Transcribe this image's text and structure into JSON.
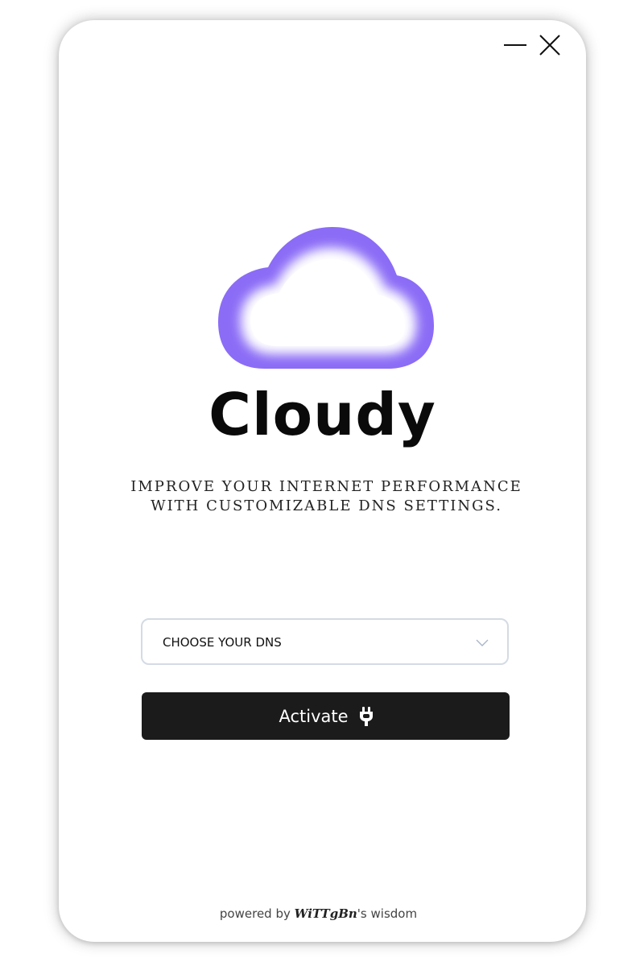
{
  "window": {
    "minimize_icon": "minimize-icon",
    "close_icon": "close-icon"
  },
  "app": {
    "title": "Cloudy",
    "logo_icon": "cloud-icon",
    "tagline_line1": "IMPROVE YOUR INTERNET PERFORMANCE",
    "tagline_line2": "WITH CUSTOMIZABLE DNS SETTINGS."
  },
  "dns_select": {
    "selected": "CHOOSE YOUR DNS",
    "icon": "chevron-down-icon"
  },
  "activate_button": {
    "label": "Activate",
    "icon": "plug-icon"
  },
  "footer": {
    "prefix": "powered by",
    "brand": "WiTTgBn",
    "suffix": "'s wisdom"
  },
  "colors": {
    "cloud_accent": "#8b6cf6",
    "button_bg": "#1b1b1b",
    "select_border": "#d4dbe4"
  }
}
